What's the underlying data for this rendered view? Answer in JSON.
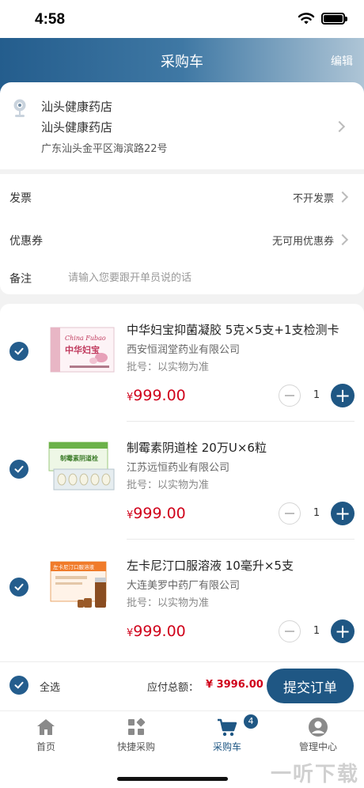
{
  "status_bar": {
    "time": "4:58"
  },
  "nav": {
    "title": "采购车",
    "edit_label": "编辑"
  },
  "address": {
    "name": "汕头健康药店",
    "contact": "汕头健康药店",
    "detail": "广东汕头金平区海滨路22号"
  },
  "invoice": {
    "label": "发票",
    "value": "不开发票"
  },
  "coupon": {
    "label": "优惠券",
    "value": "无可用优惠券"
  },
  "remark": {
    "label": "备注",
    "placeholder": "请输入您要跟开单员说的话"
  },
  "products": [
    {
      "name": "中华妇宝抑菌凝胶 5克×5支+1支检测卡",
      "maker": "西安恒润堂药业有限公司",
      "batch": "批号：以实物为准",
      "currency": "¥",
      "price": "999.00",
      "qty": "1"
    },
    {
      "name": "制霉素阴道栓 20万U×6粒",
      "maker": "江苏远恒药业有限公司",
      "batch": "批号：以实物为准",
      "currency": "¥",
      "price": "999.00",
      "qty": "1"
    },
    {
      "name": "左卡尼汀口服溶液 10毫升×5支",
      "maker": "大连美罗中药厂有限公司",
      "batch": "批号：以实物为准",
      "currency": "¥",
      "price": "999.00",
      "qty": "1"
    }
  ],
  "product_box_text": {
    "box1_brand": "China Fubao",
    "box1_cn": "中华妇宝",
    "box2_cn": "制霉素阴道栓",
    "box3_cn": "左卡尼汀口服溶液"
  },
  "footer": {
    "select_all_label": "全选",
    "total_label": "应付总额：",
    "total_value": "¥ 3996.00",
    "submit_label": "提交订单"
  },
  "tabbar": {
    "tabs": [
      {
        "label": "首页",
        "icon": "home-icon"
      },
      {
        "label": "快捷采购",
        "icon": "grid-icon"
      },
      {
        "label": "采购车",
        "icon": "cart-icon"
      },
      {
        "label": "管理中心",
        "icon": "user-icon"
      }
    ],
    "cart_badge": "4",
    "active": 2
  },
  "watermark": "一听下载",
  "colors": {
    "primary": "#1f5784",
    "price": "#d0021b"
  }
}
